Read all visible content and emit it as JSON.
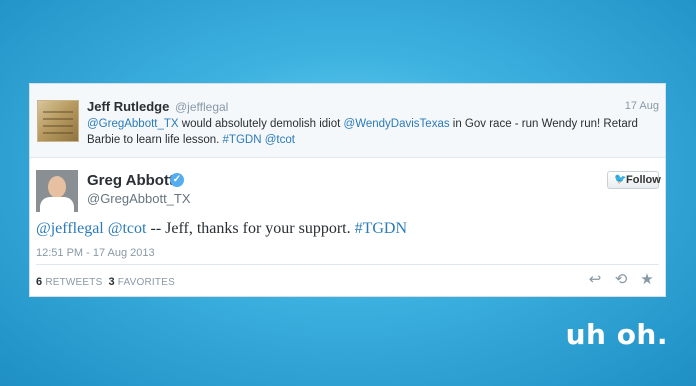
{
  "reply_tweet": {
    "name": "Jeff Rutledge",
    "handle": "@jefflegal",
    "time": "17 Aug",
    "mention1": "@GregAbbott_TX",
    "text1": " would absolutely demolish idiot ",
    "mention2": "@WendyDavisTexas",
    "text2": " in Gov race - run Wendy run! Retard Barbie to learn life lesson. ",
    "hashtag": "#TGDN",
    "mention3": "@tcot"
  },
  "main_tweet": {
    "name": "Greg Abbott",
    "handle": "@GregAbbott_TX",
    "follow_label": "Follow",
    "mention1": "@jefflegal",
    "mention2": "@tcot",
    "text": " -- Jeff, thanks for your support. ",
    "hashtag": "#TGDN",
    "timestamp": "12:51 PM - 17 Aug 2013",
    "retweets_count": "6",
    "retweets_label": "RETWEETS",
    "favorites_count": "3",
    "favorites_label": "FAVORITES"
  },
  "caption": "uh oh.",
  "colors": {
    "link": "#2b7bb9",
    "verified": "#55acee",
    "background": "#3db2e0"
  },
  "icons": [
    "reply-icon",
    "retweet-icon",
    "favorite-icon",
    "twitter-bird-icon",
    "verified-badge-icon"
  ]
}
